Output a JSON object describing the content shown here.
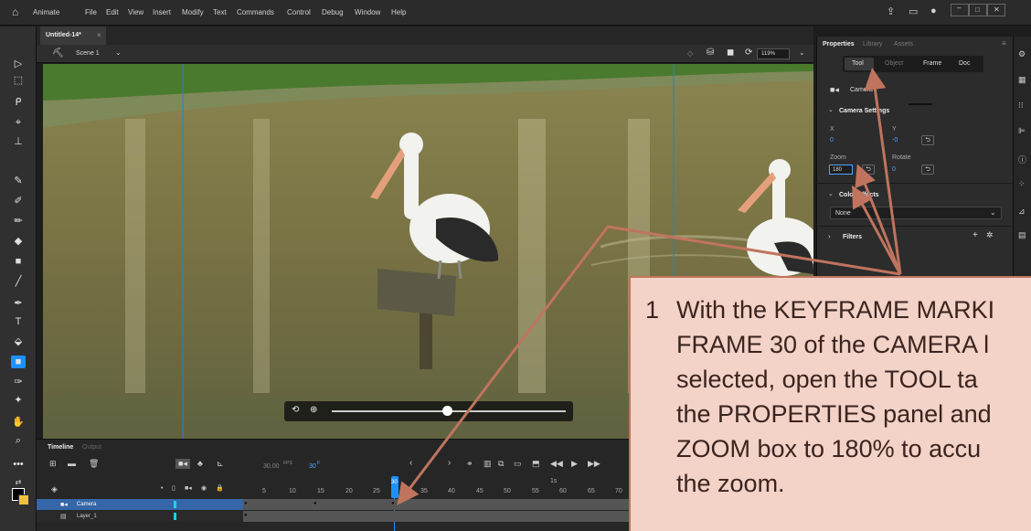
{
  "menubar": {
    "app_label": "Animate",
    "items": [
      "File",
      "Edit",
      "View",
      "Insert",
      "Modify",
      "Text",
      "Commands",
      "Control",
      "Debug",
      "Window",
      "Help"
    ]
  },
  "document": {
    "tab_label": "Untitled-14*",
    "close_glyph": "×"
  },
  "scene": {
    "label": "Scene 1",
    "zoom": "119%"
  },
  "properties": {
    "tabs": [
      "Properties",
      "Library",
      "Assets"
    ],
    "subtabs": [
      "Tool",
      "Object",
      "Frame",
      "Doc"
    ],
    "camera_label": "Camera",
    "camera_settings_label": "Camera Settings",
    "x_label": "X",
    "x_value": "0",
    "y_label": "Y",
    "y_value": "-0",
    "zoom_label": "Zoom",
    "zoom_value": "180",
    "rotate_label": "Rotate",
    "rotate_value": "0",
    "color_effects_label": "Color Effects",
    "color_effects_value": "None",
    "filters_label": "Filters"
  },
  "timeline": {
    "tabs": [
      "Timeline",
      "Output"
    ],
    "fps": "30.00",
    "fps_unit": "FPS",
    "frame": "30",
    "frame_unit": "F",
    "ruler_ticks": [
      "5",
      "10",
      "15",
      "20",
      "25",
      "30",
      "35",
      "40",
      "45",
      "50",
      "55",
      "60",
      "65",
      "70"
    ],
    "ruler_secs": [
      "1s",
      "2s"
    ],
    "layers": [
      "Camera",
      "Layer_1"
    ]
  },
  "callout": {
    "number": "1",
    "lines": [
      "With the KEYFRAME MARKI",
      "FRAME 30 of the CAMERA l",
      "selected, open the TOOL ta",
      "the PROPERTIES panel and",
      "ZOOM box to 180% to accu",
      "the zoom."
    ]
  },
  "colors": {
    "accent": "#1e90ff",
    "arrow": "#c0745e",
    "callout_bg": "#f3d2c7"
  }
}
